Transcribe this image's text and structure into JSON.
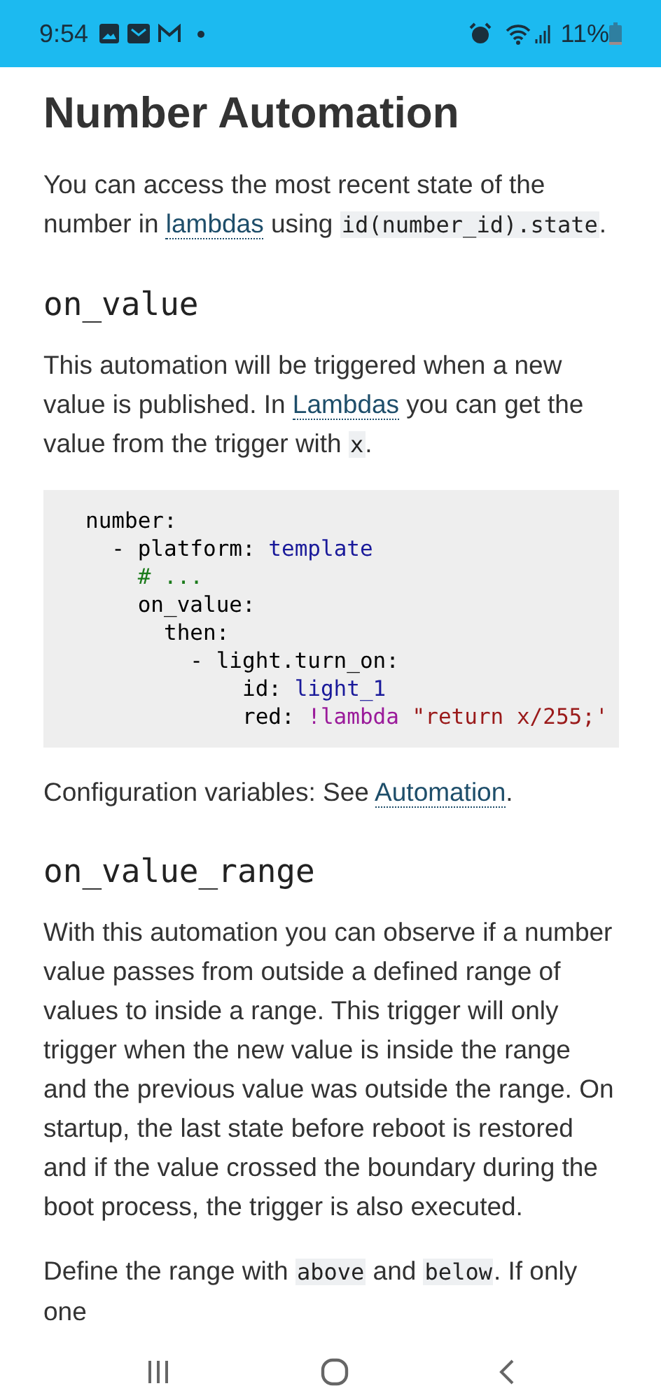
{
  "status_bar": {
    "time": "9:54",
    "battery": "11%"
  },
  "title": "Number Automation",
  "sections": [
    {
      "kind": "paragraph",
      "segments": [
        {
          "kind": "text",
          "text": "You can access the most recent state of the number in "
        },
        {
          "kind": "link",
          "text": "lambdas"
        },
        {
          "kind": "text",
          "text": " using "
        },
        {
          "kind": "code",
          "text": "id(number_id).state"
        },
        {
          "kind": "text",
          "text": "."
        }
      ]
    },
    {
      "kind": "heading",
      "text": "on_value"
    },
    {
      "kind": "paragraph",
      "segments": [
        {
          "kind": "text",
          "text": "This automation will be triggered when a new value is published. In "
        },
        {
          "kind": "link",
          "text": "Lambdas"
        },
        {
          "kind": "text",
          "text": " you can get the value from the trigger with "
        },
        {
          "kind": "code",
          "text": "x"
        },
        {
          "kind": "text",
          "text": "."
        }
      ]
    },
    {
      "kind": "code_block",
      "lines": [
        [
          {
            "kind": "plain",
            "text": "number:"
          }
        ],
        [
          {
            "kind": "plain",
            "text": "  - platform: "
          },
          {
            "kind": "value",
            "text": "template"
          }
        ],
        [
          {
            "kind": "comment",
            "text": "    # ..."
          }
        ],
        [
          {
            "kind": "plain",
            "text": "    on_value:"
          }
        ],
        [
          {
            "kind": "plain",
            "text": "      then:"
          }
        ],
        [
          {
            "kind": "plain",
            "text": "        - light.turn_on:"
          }
        ],
        [
          {
            "kind": "plain",
            "text": "            id: "
          },
          {
            "kind": "value",
            "text": "light_1"
          }
        ],
        [
          {
            "kind": "plain",
            "text": "            red: "
          },
          {
            "kind": "tag",
            "text": "!lambda "
          },
          {
            "kind": "string",
            "text": "\"return x/255;'"
          }
        ]
      ]
    },
    {
      "kind": "paragraph",
      "segments": [
        {
          "kind": "text",
          "text": "Configuration variables: See "
        },
        {
          "kind": "link",
          "text": "Automation"
        },
        {
          "kind": "text",
          "text": "."
        }
      ]
    },
    {
      "kind": "heading",
      "text": "on_value_range"
    },
    {
      "kind": "paragraph",
      "segments": [
        {
          "kind": "text",
          "text": "With this automation you can observe if a number value passes from outside a defined range of values to inside a range. This trigger will only trigger when the new value is inside the range and the previous value was outside the range. On startup, the last state before reboot is restored and if the value crossed the boundary during the boot process, the trigger is also executed."
        }
      ]
    },
    {
      "kind": "paragraph",
      "segments": [
        {
          "kind": "text",
          "text": "Define the range with "
        },
        {
          "kind": "code",
          "text": "above"
        },
        {
          "kind": "text",
          "text": " and "
        },
        {
          "kind": "code",
          "text": "below"
        },
        {
          "kind": "text",
          "text": ". If only one"
        }
      ]
    }
  ]
}
